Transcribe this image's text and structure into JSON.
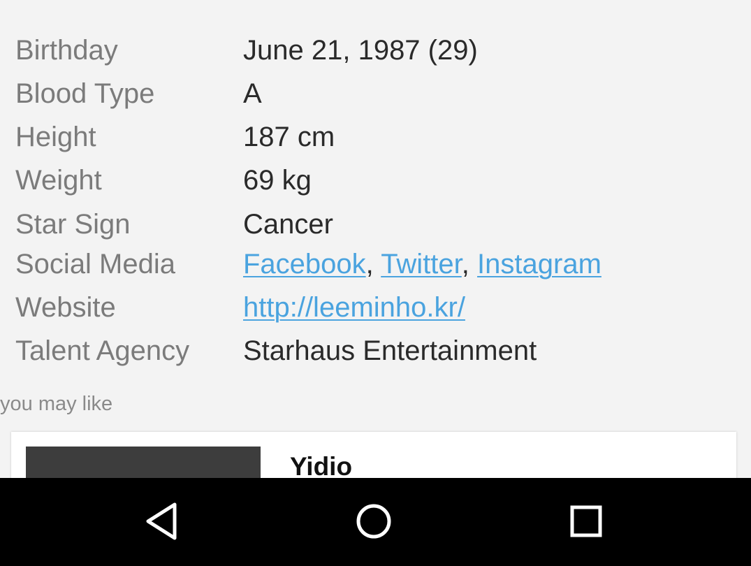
{
  "profile": {
    "rows": [
      {
        "label": "Birthday",
        "value": "June 21, 1987 (29)"
      },
      {
        "label": "Blood Type",
        "value": "A"
      },
      {
        "label": "Height",
        "value": "187 cm"
      },
      {
        "label": "Weight",
        "value": "69 kg"
      },
      {
        "label": "Star Sign",
        "value": "Cancer"
      },
      {
        "label": "Social Media",
        "links": [
          "Facebook",
          "Twitter",
          "Instagram"
        ],
        "separator": ","
      },
      {
        "label": "Website",
        "link": "http://leeminho.kr/"
      },
      {
        "label": "Talent Agency",
        "value": "Starhaus Entertainment"
      }
    ]
  },
  "recommendations": {
    "heading": "you may like",
    "items": [
      {
        "title": "Yidio"
      }
    ]
  },
  "navbar": {
    "back_icon": "back-triangle-icon",
    "home_icon": "home-circle-icon",
    "recents_icon": "recents-square-icon"
  },
  "colors": {
    "background": "#f3f3f3",
    "label": "#7b7b7b",
    "value": "#2a2a2a",
    "link": "#4aa3df",
    "navbar": "#000000"
  }
}
